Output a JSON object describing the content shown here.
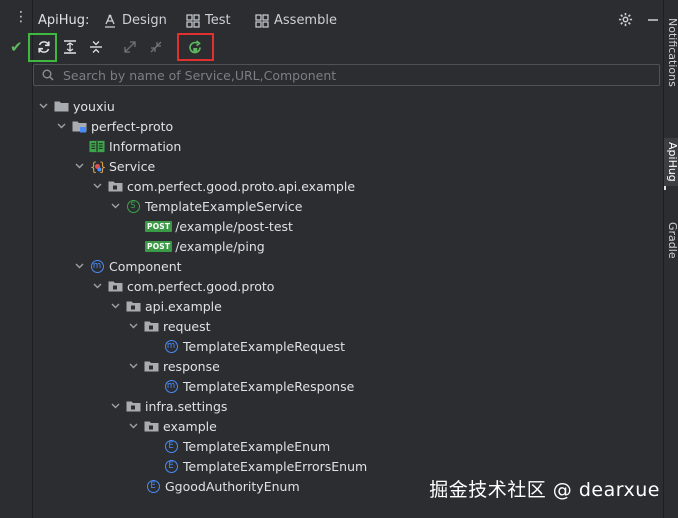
{
  "header": {
    "brand": "ApiHug:",
    "tabs": [
      {
        "label": "Design",
        "icon": "design-icon"
      },
      {
        "label": "Test",
        "icon": "test-icon"
      },
      {
        "label": "Assemble",
        "icon": "assemble-icon"
      }
    ]
  },
  "toolbar": {
    "buttons": [
      "refresh-icon",
      "expand-all-icon",
      "collapse-all-icon",
      "expand-icon",
      "collapse-icon",
      "sync-icon"
    ]
  },
  "search": {
    "placeholder": "Search by name of Service,URL,Component"
  },
  "tree": {
    "root": "youxiu",
    "project": "perfect-proto",
    "information": "Information",
    "service": "Service",
    "service_package": "com.perfect.good.proto.api.example",
    "service_class": "TemplateExampleService",
    "post_badge": "POST",
    "endpoint_1": "/example/post-test",
    "endpoint_2": "/example/ping",
    "component": "Component",
    "component_package": "com.perfect.good.proto",
    "api_example": "api.example",
    "request": "request",
    "request_class": "TemplateExampleRequest",
    "response": "response",
    "response_class": "TemplateExampleResponse",
    "infra_settings": "infra.settings",
    "example": "example",
    "enum_1": "TemplateExampleEnum",
    "enum_2": "TemplateExampleErrorsEnum",
    "enum_3": "GgoodAuthorityEnum"
  },
  "right_panel": {
    "notifications": "Notifications",
    "apihug": "ApiHug",
    "gradle": "Gradle"
  },
  "watermark": "掘金技术社区 @ dearxue",
  "colors": {
    "background": "#2b2d30",
    "accent_blue": "#4a8cf7",
    "post_green": "#3b9a45",
    "highlight_green": "#3fb83f",
    "highlight_red": "#e03030"
  }
}
